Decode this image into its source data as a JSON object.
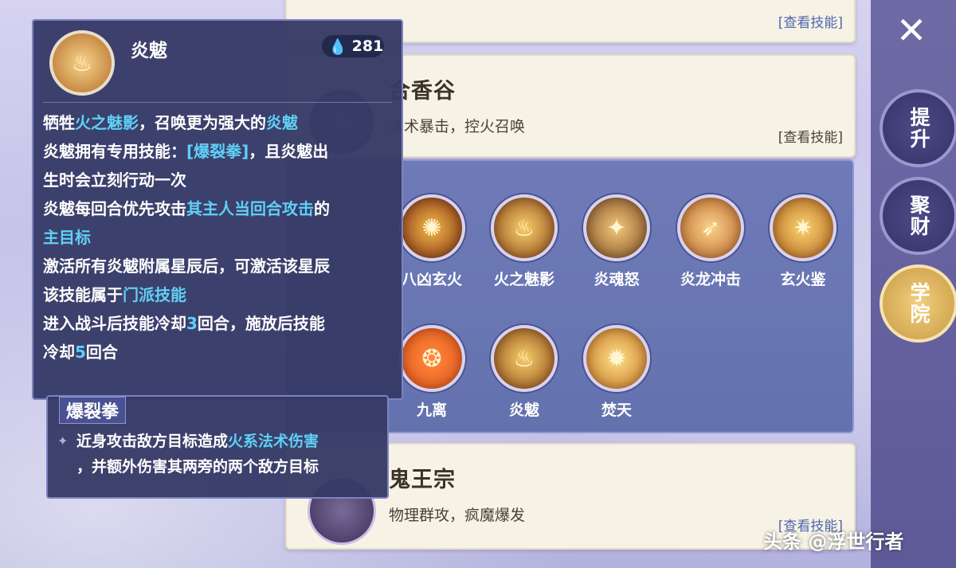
{
  "schools": {
    "top": {
      "view_label": "[查看技能]"
    },
    "hexiang": {
      "name": "合香谷",
      "desc": "法术暴击，控火召唤",
      "view_label": "[查看技能]"
    },
    "guiwang": {
      "name": "鬼王宗",
      "desc": "物理群攻，疯魔爆发",
      "view_label": "[查看技能]"
    }
  },
  "skills": [
    {
      "name": "八凶玄火",
      "icon": "fire-orb-icon",
      "glyph": "✺"
    },
    {
      "name": "火之魅影",
      "icon": "fire-demon-icon",
      "glyph": "♨"
    },
    {
      "name": "炎魂怒",
      "icon": "fire-book-icon",
      "glyph": "✦"
    },
    {
      "name": "炎龙冲击",
      "icon": "fire-dragon-icon",
      "glyph": "➶"
    },
    {
      "name": "玄火鉴",
      "icon": "fire-dragon-head-icon",
      "glyph": "✷"
    },
    {
      "name": "九离",
      "icon": "flame-sigil-icon",
      "glyph": "❂"
    },
    {
      "name": "炎魃",
      "icon": "fire-demon-icon",
      "glyph": "♨"
    },
    {
      "name": "焚天",
      "icon": "fire-swirl-icon",
      "glyph": "✹"
    }
  ],
  "nav": [
    {
      "label": "提升",
      "active": false
    },
    {
      "label": "聚财",
      "active": false
    },
    {
      "label": "学院",
      "active": true
    }
  ],
  "tooltip": {
    "name": "炎魃",
    "cost": "281",
    "lines": {
      "l1a": "牺牲",
      "l1b": "火之魅影",
      "l1c": "，召唤更为强大的",
      "l1d": "炎魃",
      "l2a": "炎魃拥有专用技能：",
      "l2b": "[爆裂拳]",
      "l2c": "，且炎魃出",
      "l3": "生时会立刻行动一次",
      "l4a": "炎魃每回合优先攻击",
      "l4b": "其主人当回合攻击",
      "l4c": "的",
      "l5": "主目标",
      "l6": "激活所有炎魃附属星辰后，可激活该星辰",
      "l7a": "该技能属于",
      "l7b": "门派技能",
      "l8a": "进入战斗后技能冷却",
      "l8b": "3",
      "l8c": "回合，施放后技能",
      "l9a": "冷却",
      "l9b": "5",
      "l9c": "回合"
    }
  },
  "subtip": {
    "name": "爆裂拳",
    "d1a": "近身攻击敌方目标造成",
    "d1b": "火系法术伤害",
    "d2": "，并额外伤害其两旁的两个敌方目标"
  },
  "watermark": "头条 @浮世行者"
}
